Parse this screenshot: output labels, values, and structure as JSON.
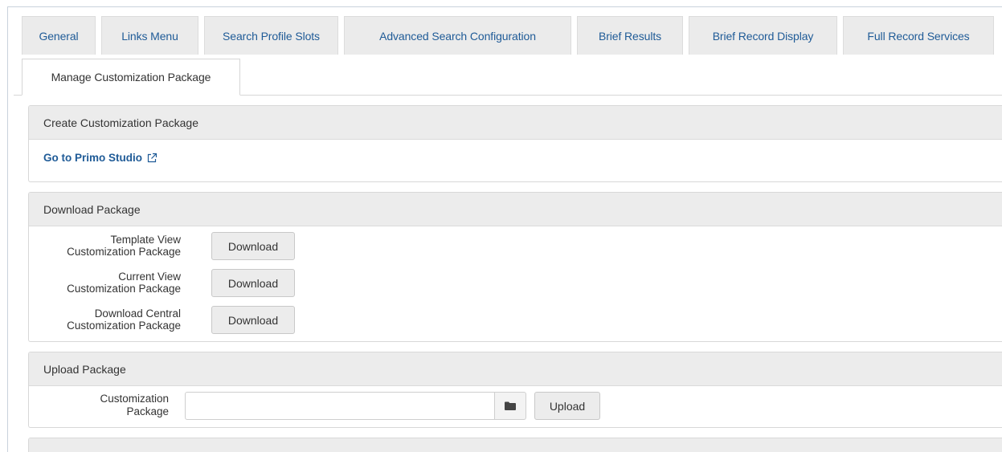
{
  "tabs": [
    {
      "label": "General"
    },
    {
      "label": "Links Menu"
    },
    {
      "label": "Search Profile Slots"
    },
    {
      "label": "Advanced Search Configuration"
    },
    {
      "label": "Brief Results"
    },
    {
      "label": "Brief Record Display"
    },
    {
      "label": "Full Record Services"
    },
    {
      "label": "Manage Customization Package"
    }
  ],
  "create_panel": {
    "title": "Create Customization Package",
    "studio_link": "Go to Primo Studio"
  },
  "download_panel": {
    "title": "Download Package",
    "rows": [
      {
        "label_line1": "Template View",
        "label_line2": "Customization Package",
        "button": "Download"
      },
      {
        "label_line1": "Current View",
        "label_line2": "Customization Package",
        "button": "Download"
      },
      {
        "label_line1": "Download Central",
        "label_line2": "Customization Package",
        "button": "Download"
      }
    ]
  },
  "upload_panel": {
    "title": "Upload Package",
    "label_line1": "Customization",
    "label_line2": "Package",
    "file_value": "",
    "upload_button": "Upload"
  },
  "icons": {
    "studio_link_icon": "external-link-icon",
    "file_picker_icon": "folder-icon"
  },
  "colors": {
    "link": "#1f5b97",
    "panel_header": "#ececec",
    "tab_bg": "#ebebeb"
  }
}
